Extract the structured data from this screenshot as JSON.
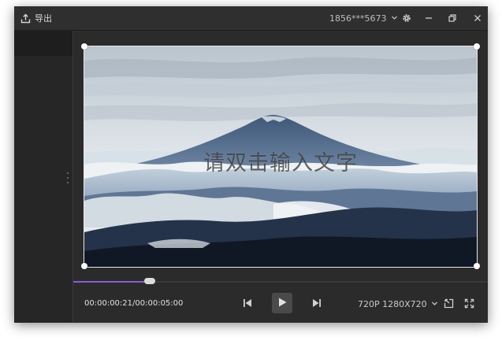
{
  "toolbar": {
    "export_label": "导出",
    "account": "1856***5673"
  },
  "icons": {
    "export": "upload-icon",
    "account_dropdown": "chevron-down-icon",
    "settings": "gear-icon",
    "minimize": "minimize-icon",
    "restore": "restore-icon",
    "close": "close-icon",
    "prev": "skip-back-icon",
    "play": "play-icon",
    "next": "skip-forward-icon",
    "resolution_dropdown": "chevron-down-icon",
    "popout": "popout-icon",
    "fullscreen": "fullscreen-icon"
  },
  "canvas": {
    "overlay_text": "请双击输入文字"
  },
  "player": {
    "timecode": "00:00:00:21/00:00:05:00",
    "progress_fraction": 0.18,
    "resolution": "720P 1280X720"
  },
  "colors": {
    "accent": "#8a5cd6",
    "window_bg": "#2b2b2c"
  }
}
